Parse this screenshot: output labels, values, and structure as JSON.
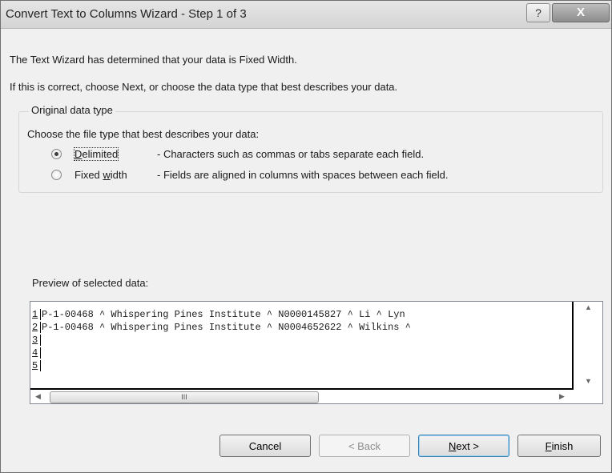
{
  "window": {
    "title": "Convert Text to Columns Wizard - Step 1 of 3",
    "help_label": "?",
    "close_label": "X"
  },
  "intro": {
    "line1": "The Text Wizard has determined that your data is Fixed Width.",
    "line2": "If this is correct, choose Next, or choose the data type that best describes your data."
  },
  "data_type": {
    "group_label": "Original data type",
    "prompt": "Choose the file type that best describes your data:",
    "options": [
      {
        "label": "Delimited",
        "accel": "D",
        "description": "- Characters such as commas or tabs separate each field.",
        "selected": true
      },
      {
        "label": "Fixed width",
        "accel": "w",
        "description": "- Fields are aligned in columns with spaces between each field.",
        "selected": false
      }
    ]
  },
  "preview": {
    "label": "Preview of selected data:",
    "rows": [
      {
        "num": "1",
        "text": "P-1-00468 ^ Whispering Pines Institute ^ N0000145827 ^ Li ^ Lyn"
      },
      {
        "num": "2",
        "text": "P-1-00468 ^ Whispering Pines Institute ^ N0004652622 ^ Wilkins ^"
      },
      {
        "num": "3",
        "text": ""
      },
      {
        "num": "4",
        "text": ""
      },
      {
        "num": "5",
        "text": ""
      }
    ],
    "hscroll_thumb_glyph": "III"
  },
  "buttons": {
    "cancel": "Cancel",
    "back": "< Back",
    "next": "Next >",
    "finish": "Finish"
  }
}
